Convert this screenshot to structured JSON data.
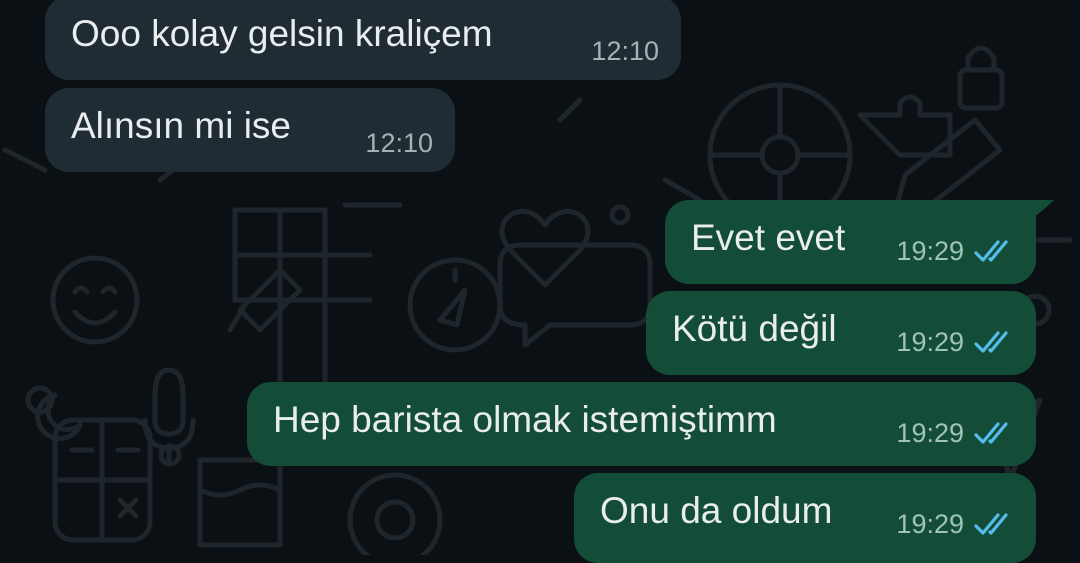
{
  "messages": [
    {
      "direction": "incoming",
      "text": "Ooo kolay gelsin kraliçem",
      "time": "12:10"
    },
    {
      "direction": "incoming",
      "text": "Alınsın mi ise",
      "time": "12:10"
    },
    {
      "direction": "outgoing",
      "text": "Evet evet",
      "time": "19:29",
      "status": "read"
    },
    {
      "direction": "outgoing",
      "text": "Kötü değil",
      "time": "19:29",
      "status": "read"
    },
    {
      "direction": "outgoing",
      "text": "Hep barista olmak istemiştimm",
      "time": "19:29",
      "status": "read"
    },
    {
      "direction": "outgoing",
      "text": "Onu da oldum",
      "time": "19:29",
      "status": "read"
    }
  ],
  "colors": {
    "background": "#0b1014",
    "incoming_bubble": "#202c33",
    "outgoing_bubble": "#144d37",
    "message_text": "#e9edef",
    "read_ticks": "#53bdeb"
  },
  "icons": [
    "double-check-read-icon"
  ]
}
